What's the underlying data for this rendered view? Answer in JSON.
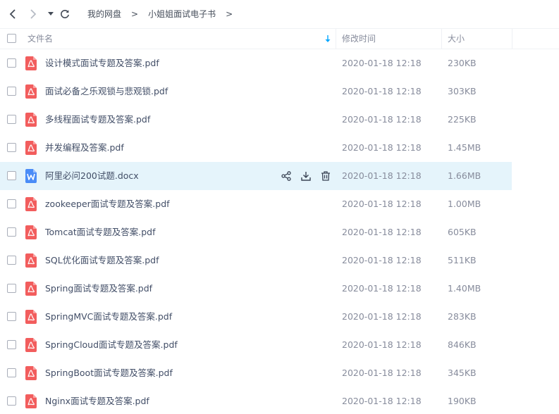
{
  "nav": {
    "breadcrumb": [
      "我的网盘",
      "小姐姐面试电子书"
    ],
    "separator": ">"
  },
  "columns": {
    "name": "文件名",
    "modified": "修改时间",
    "size": "大小"
  },
  "colors": {
    "accent": "#06a7ff",
    "pdf_icon": "#f25d5d",
    "word_icon": "#4a8cf7",
    "row_hover": "#e5f4fb"
  },
  "files": [
    {
      "name": "设计模式面试专题及答案.pdf",
      "modified": "2020-01-18 12:18",
      "size": "230KB",
      "type": "pdf"
    },
    {
      "name": "面试必备之乐观锁与悲观锁.pdf",
      "modified": "2020-01-18 12:18",
      "size": "303KB",
      "type": "pdf"
    },
    {
      "name": "多线程面试专题及答案.pdf",
      "modified": "2020-01-18 12:18",
      "size": "225KB",
      "type": "pdf"
    },
    {
      "name": "并发编程及答案.pdf",
      "modified": "2020-01-18 12:18",
      "size": "1.45MB",
      "type": "pdf"
    },
    {
      "name": "阿里必问200试题.docx",
      "modified": "2020-01-18 12:18",
      "size": "1.66MB",
      "type": "docx",
      "hovered": true
    },
    {
      "name": "zookeeper面试专题及答案.pdf",
      "modified": "2020-01-18 12:18",
      "size": "1.00MB",
      "type": "pdf"
    },
    {
      "name": "Tomcat面试专题及答案.pdf",
      "modified": "2020-01-18 12:18",
      "size": "605KB",
      "type": "pdf"
    },
    {
      "name": "SQL优化面试专题及答案.pdf",
      "modified": "2020-01-18 12:18",
      "size": "511KB",
      "type": "pdf"
    },
    {
      "name": "Spring面试专题及答案.pdf",
      "modified": "2020-01-18 12:18",
      "size": "1.40MB",
      "type": "pdf"
    },
    {
      "name": "SpringMVC面试专题及答案.pdf",
      "modified": "2020-01-18 12:18",
      "size": "283KB",
      "type": "pdf"
    },
    {
      "name": "SpringCloud面试专题及答案.pdf",
      "modified": "2020-01-18 12:18",
      "size": "846KB",
      "type": "pdf"
    },
    {
      "name": "SpringBoot面试专题及答案.pdf",
      "modified": "2020-01-18 12:18",
      "size": "345KB",
      "type": "pdf"
    },
    {
      "name": "Nginx面试专题及答案.pdf",
      "modified": "2020-01-18 12:18",
      "size": "190KB",
      "type": "pdf"
    }
  ],
  "icons": {
    "back": "chevron-left-icon",
    "forward": "chevron-right-icon",
    "history": "caret-down-icon",
    "refresh": "refresh-icon",
    "sort": "sort-down-arrow-icon",
    "share": "share-icon",
    "download": "download-icon",
    "delete": "trash-icon"
  }
}
